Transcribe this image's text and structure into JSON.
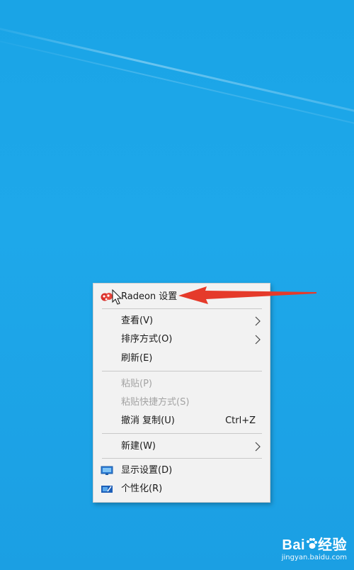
{
  "context_menu": {
    "items": [
      {
        "label": "Radeon 设置",
        "icon": "radeon-icon"
      },
      {
        "label": "查看(V)",
        "submenu": true
      },
      {
        "label": "排序方式(O)",
        "submenu": true
      },
      {
        "label": "刷新(E)"
      },
      {
        "label": "粘贴(P)",
        "disabled": true
      },
      {
        "label": "粘贴快捷方式(S)",
        "disabled": true
      },
      {
        "label": "撤消 复制(U)",
        "shortcut": "Ctrl+Z"
      },
      {
        "label": "新建(W)",
        "submenu": true
      },
      {
        "label": "显示设置(D)",
        "icon": "display-settings-icon"
      },
      {
        "label": "个性化(R)",
        "icon": "personalize-icon"
      }
    ]
  },
  "annotation": {
    "color": "#e53a2a"
  },
  "watermark": {
    "brand_left": "Bai",
    "brand_right": "经验",
    "site": "jingyan.baidu.com"
  },
  "colors": {
    "desktop": "#1ea8ea",
    "menu_bg": "#f2f2f2",
    "disabled_text": "#a3a3a3"
  }
}
